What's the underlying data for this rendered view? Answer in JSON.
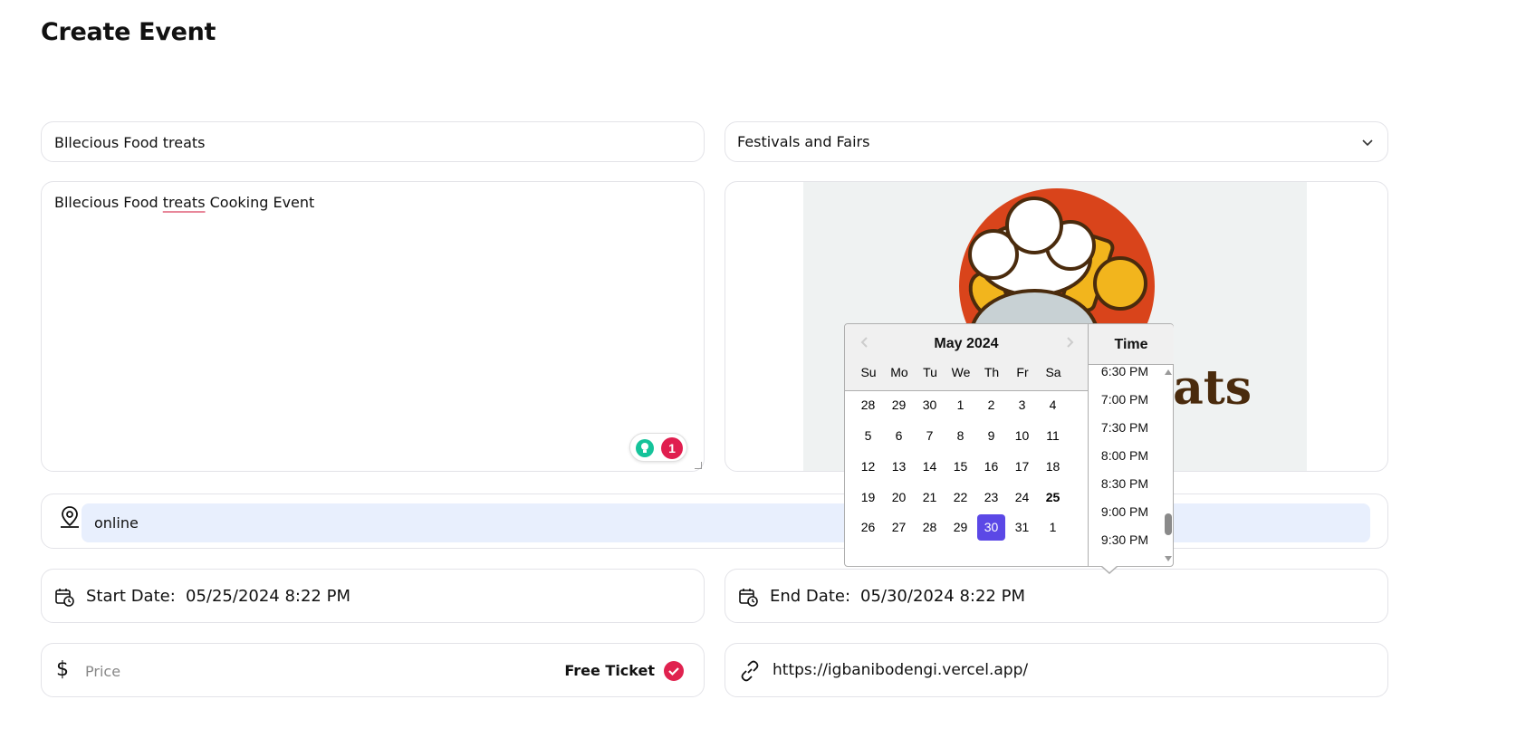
{
  "page": {
    "title": "Create Event"
  },
  "form": {
    "event_title": "Bllecious Food treats",
    "category": "Festivals and Fairs",
    "description_parts": [
      "Bllecious Food ",
      "treats",
      " Cooking Event"
    ],
    "grammar_badge_count": "1",
    "location": "online",
    "start_date_label": "Start Date:",
    "start_date_value": "05/25/2024 8:22 PM",
    "end_date_label": "End Date:",
    "end_date_value": "05/30/2024 8:22 PM",
    "price_placeholder": "Price",
    "currency_symbol": "$",
    "free_ticket_label": "Free Ticket",
    "free_ticket_checked": true,
    "url": "https://igbanibodengi.vercel.app/"
  },
  "image": {
    "visible_text": "eats"
  },
  "datepicker": {
    "month_label": "May 2024",
    "weekdays": [
      "Su",
      "Mo",
      "Tu",
      "We",
      "Th",
      "Fr",
      "Sa"
    ],
    "weeks": [
      [
        "28",
        "29",
        "30",
        "1",
        "2",
        "3",
        "4"
      ],
      [
        "5",
        "6",
        "7",
        "8",
        "9",
        "10",
        "11"
      ],
      [
        "12",
        "13",
        "14",
        "15",
        "16",
        "17",
        "18"
      ],
      [
        "19",
        "20",
        "21",
        "22",
        "23",
        "24",
        "25"
      ],
      [
        "26",
        "27",
        "28",
        "29",
        "30",
        "31",
        "1"
      ]
    ],
    "today": "25",
    "selected": "30",
    "time_header": "Time",
    "times": [
      "6:30 PM",
      "7:00 PM",
      "7:30 PM",
      "8:00 PM",
      "8:30 PM",
      "9:00 PM",
      "9:30 PM"
    ]
  },
  "colors": {
    "accent": "#5b48e6",
    "check": "#e0224f",
    "location_bg": "#e8effd"
  },
  "icons": [
    "chevron-down-icon",
    "map-pin-icon",
    "calendar-clock-icon",
    "dollar-icon",
    "check-icon",
    "link-icon",
    "grammarly-icon"
  ]
}
